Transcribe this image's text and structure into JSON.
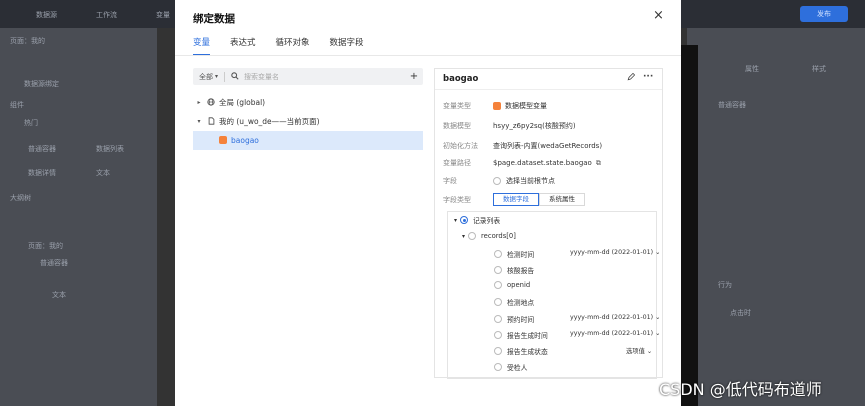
{
  "background": {
    "topbar": [
      "数据源",
      "工作流",
      "变量"
    ],
    "left_panel": [
      "页面：我的",
      "数据源绑定",
      "组件",
      "热门",
      "普通容器",
      "数据列表",
      "数据详情",
      "文本",
      "大纲树",
      "页面：我的",
      "普通容器",
      "文本"
    ],
    "right_panel": [
      "属性",
      "样式",
      "普通容器",
      "行为",
      "点击时"
    ],
    "publish_label": "发布"
  },
  "modal": {
    "title": "绑定数据",
    "close": "×",
    "tabs": [
      "变量",
      "表达式",
      "循环对象",
      "数据字段"
    ],
    "active_tab": 0
  },
  "left": {
    "scope": "全部",
    "search_placeholder": "搜索变量名",
    "add": "+",
    "tree": [
      {
        "arrow": "▸",
        "icon": "globe-icon",
        "label": "全局 (global)"
      },
      {
        "arrow": "▾",
        "icon": "page-icon",
        "label": "我的 (u_wo_de——当前页面)"
      },
      {
        "arrow": "",
        "icon": "object-icon",
        "label": "baogao",
        "selected": true
      }
    ]
  },
  "detail": {
    "name": "baogao",
    "props": [
      {
        "key": "变量类型",
        "value": "数据模型变量"
      },
      {
        "key": "数据模型",
        "value": "hsyy_z6py2sq(核酸预约)"
      },
      {
        "key": "初始化方法",
        "value": "查询列表-内置(wedaGetRecords)"
      },
      {
        "key": "变量路径",
        "value": "$page.dataset.state.baogao"
      },
      {
        "key": "字段",
        "value": "选择当前根节点"
      },
      {
        "key": "字段类型",
        "value": ""
      }
    ],
    "field_type_options": [
      "数据字段",
      "系统属性"
    ],
    "tree": {
      "root": "记录列表",
      "child": "records[0]",
      "fields": [
        {
          "label": "检测时间",
          "format": "yyyy-mm-dd (2022-01-01)"
        },
        {
          "label": "核酸报告",
          "format": ""
        },
        {
          "label": "openid",
          "format": ""
        },
        {
          "label": "检测地点",
          "format": ""
        },
        {
          "label": "预约时间",
          "format": "yyyy-mm-dd (2022-01-01)"
        },
        {
          "label": "报告生成时间",
          "format": "yyyy-mm-dd (2022-01-01)"
        },
        {
          "label": "报告生成状态",
          "format": "选项值"
        },
        {
          "label": "受检人",
          "format": ""
        }
      ]
    }
  },
  "watermark": "CSDN @低代码布道师",
  "colors": {
    "accent": "#2e6fdc",
    "selected_bg": "#dce9fb",
    "object_icon": "#f5823b"
  }
}
